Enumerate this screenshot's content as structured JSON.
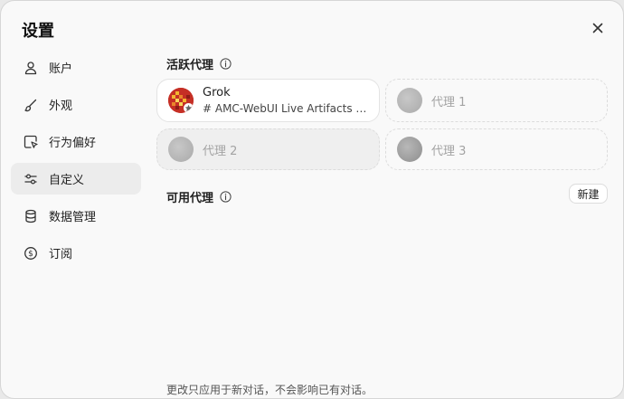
{
  "dialog": {
    "title": "设置",
    "close_icon": "close-icon"
  },
  "sidebar": {
    "items": [
      {
        "label": "账户",
        "icon": "user-icon",
        "active": false
      },
      {
        "label": "外观",
        "icon": "brush-icon",
        "active": false
      },
      {
        "label": "行为偏好",
        "icon": "cursor-window-icon",
        "active": false
      },
      {
        "label": "自定义",
        "icon": "sliders-icon",
        "active": true
      },
      {
        "label": "数据管理",
        "icon": "database-icon",
        "active": false
      },
      {
        "label": "订阅",
        "icon": "dollar-circle-icon",
        "active": false
      }
    ]
  },
  "main": {
    "active_agents": {
      "title": "活跃代理",
      "agents": [
        {
          "name": "Grok",
          "description": "# AMC-WebUI Live Artifacts De..."
        }
      ],
      "slots": [
        "代理 1",
        "代理 2",
        "代理 3"
      ]
    },
    "available_agents": {
      "title": "可用代理",
      "new_button": "新建"
    },
    "footer_note": "更改只应用于新对话，不会影响已有对话。"
  },
  "colors": {
    "accent_active_bg": "#ececec",
    "dialog_bg": "#f9f9f9"
  }
}
